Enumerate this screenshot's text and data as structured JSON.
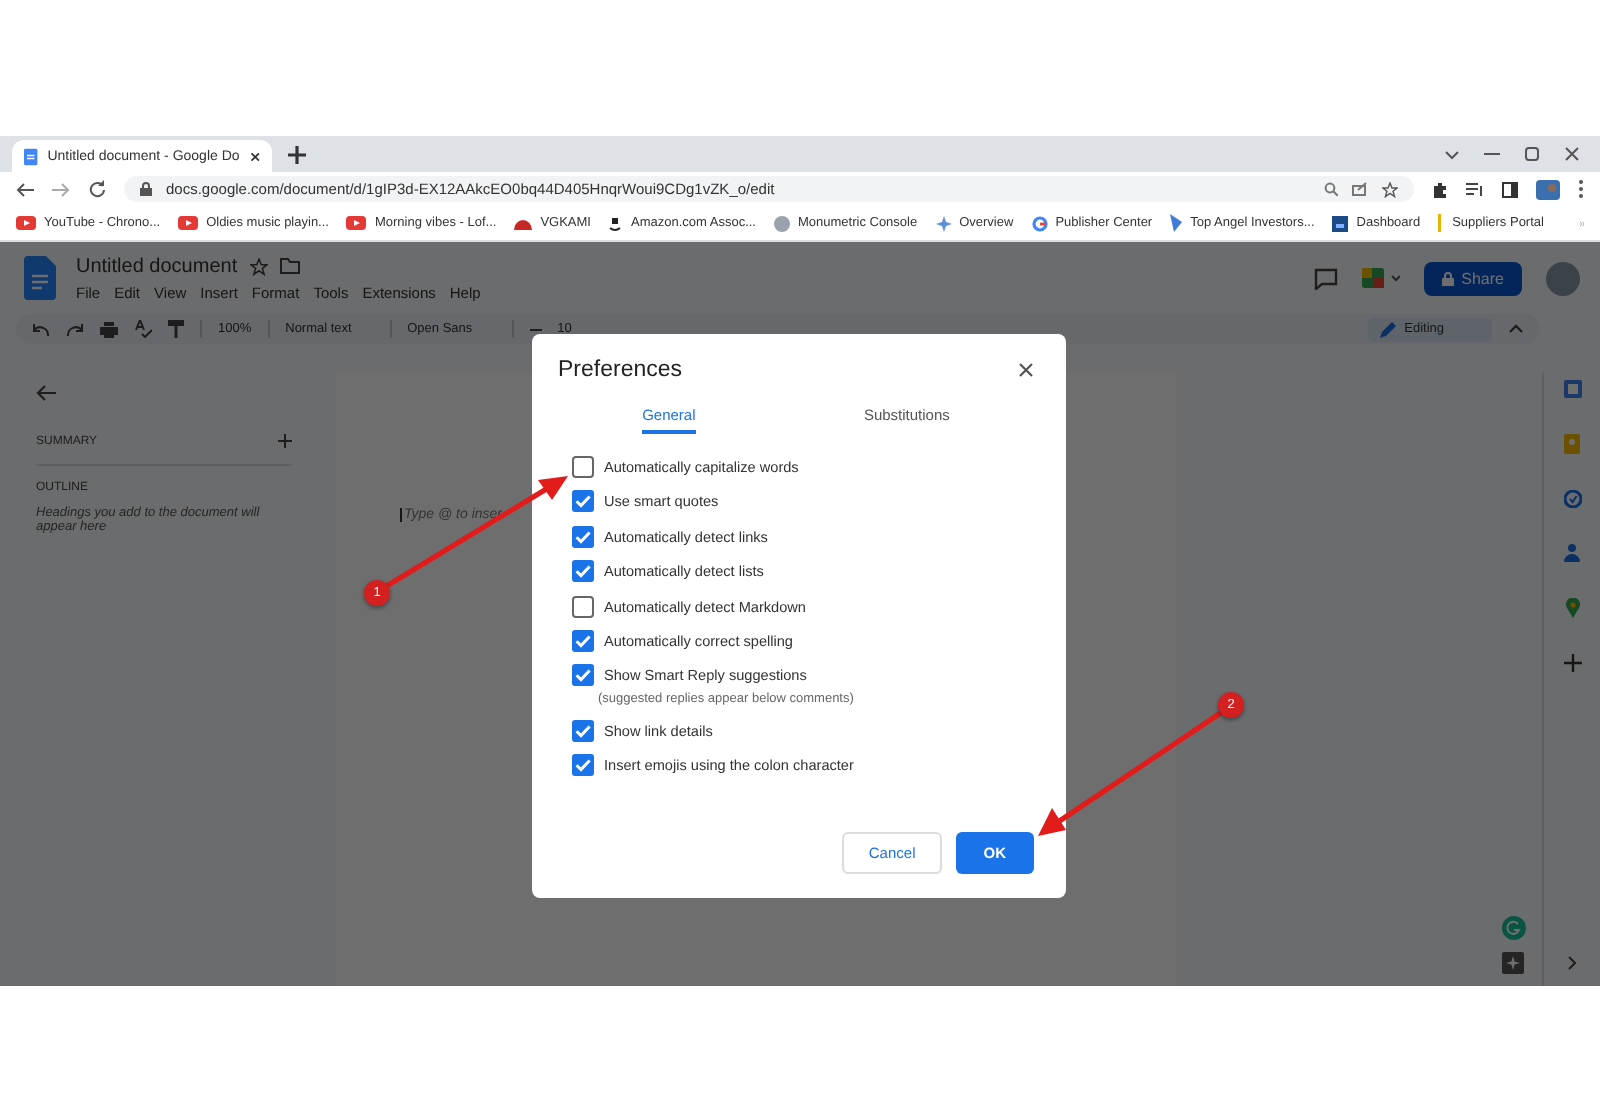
{
  "browser": {
    "tab_title": "Untitled document - Google Do",
    "url": "docs.google.com/document/d/1gIP3d-EX12AAkcEO0bq44D405HnqrWoui9CDg1vZK_o/edit",
    "bookmarks": [
      {
        "label": "YouTube - Chrono...",
        "kind": "video"
      },
      {
        "label": "Oldies music playin...",
        "kind": "video"
      },
      {
        "label": "Morning vibes - Lof...",
        "kind": "video"
      },
      {
        "label": "VGKAMI",
        "kind": "hat"
      },
      {
        "label": "Amazon.com Assoc...",
        "kind": "amazon"
      },
      {
        "label": "Monumetric Console",
        "kind": "globe"
      },
      {
        "label": "Overview",
        "kind": "sparkle"
      },
      {
        "label": "Publisher Center",
        "kind": "google"
      },
      {
        "label": "Top Angel Investors...",
        "kind": "angel"
      },
      {
        "label": "Dashboard",
        "kind": "dashboard"
      },
      {
        "label": "Suppliers Portal",
        "kind": "bar"
      }
    ]
  },
  "docs": {
    "title": "Untitled document",
    "menu": [
      "File",
      "Edit",
      "View",
      "Insert",
      "Format",
      "Tools",
      "Extensions",
      "Help"
    ],
    "toolbar": {
      "zoom": "100%",
      "style": "Normal text",
      "font": "Open Sans",
      "size": "10",
      "mode": "Editing"
    },
    "share": "Share",
    "sidebar": {
      "summary": "SUMMARY",
      "outline": "OUTLINE",
      "hint": "Headings you add to the document will appear here"
    },
    "placeholder": "Type @ to inser"
  },
  "dialog": {
    "title": "Preferences",
    "tabs": [
      {
        "label": "General",
        "selected": true
      },
      {
        "label": "Substitutions",
        "selected": false
      }
    ],
    "options": [
      {
        "label": "Automatically capitalize words",
        "checked": false
      },
      {
        "label": "Use smart quotes",
        "checked": true
      },
      {
        "label": "Automatically detect links",
        "checked": true
      },
      {
        "label": "Automatically detect lists",
        "checked": true
      },
      {
        "label": "Automatically detect Markdown",
        "checked": false
      },
      {
        "label": "Automatically correct spelling",
        "checked": true
      },
      {
        "label": "Show Smart Reply suggestions",
        "checked": true,
        "hint": "(suggested replies appear below comments)"
      },
      {
        "label": "Show link details",
        "checked": true
      },
      {
        "label": "Insert emojis using the colon character",
        "checked": true
      }
    ],
    "cancel": "Cancel",
    "ok": "OK"
  },
  "callouts": [
    "1",
    "2"
  ]
}
